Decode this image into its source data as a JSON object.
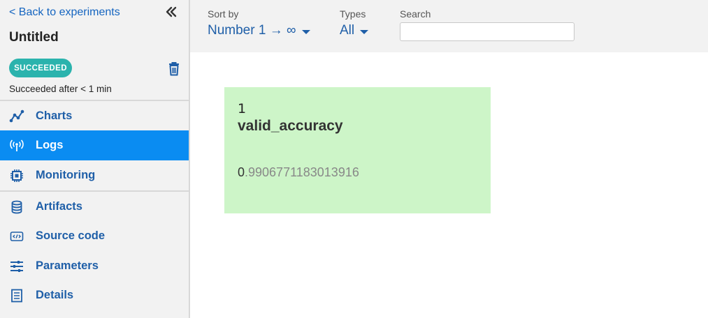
{
  "sidebar": {
    "back_label": "< Back to experiments",
    "title": "Untitled",
    "status_badge": "SUCCEEDED",
    "status_badge_color": "#2bb3ad",
    "status_text": "Succeeded after < 1 min",
    "items": [
      {
        "label": "Charts",
        "icon": "line-chart-icon",
        "active": false
      },
      {
        "label": "Logs",
        "icon": "broadcast-icon",
        "active": true
      },
      {
        "label": "Monitoring",
        "icon": "cpu-chip-icon",
        "active": false
      },
      {
        "label": "Artifacts",
        "icon": "database-icon",
        "active": false
      },
      {
        "label": "Source code",
        "icon": "code-icon",
        "active": false
      },
      {
        "label": "Parameters",
        "icon": "sliders-icon",
        "active": false
      },
      {
        "label": "Details",
        "icon": "document-icon",
        "active": false
      }
    ],
    "active_color": "#0a8cf2"
  },
  "toolbar": {
    "sort_label": "Sort by",
    "sort_value": "Number 1 → ∞",
    "types_label": "Types",
    "types_value": "All",
    "search_label": "Search",
    "search_value": "",
    "search_placeholder": ""
  },
  "log": {
    "step": "1",
    "name": "valid_accuracy",
    "value_int": "0",
    "value_frac": ".9906771183013916",
    "card_color": "#cdf5c8"
  }
}
